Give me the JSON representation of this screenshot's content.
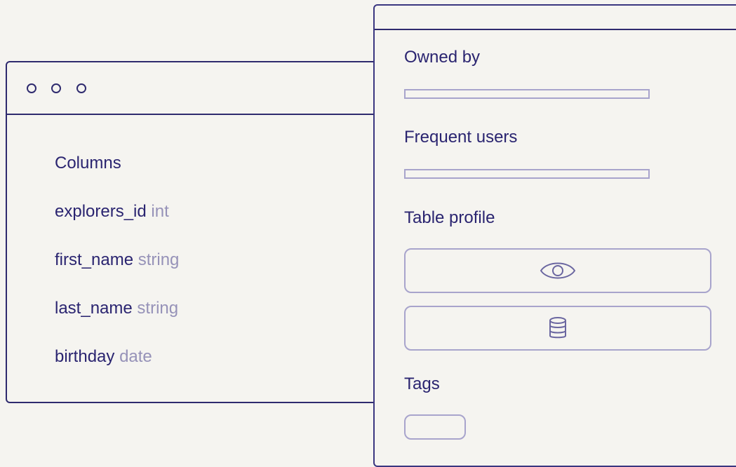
{
  "schema_window": {
    "heading": "Columns",
    "columns": [
      {
        "name": "explorers_id",
        "type": "int"
      },
      {
        "name": "first_name",
        "type": "string"
      },
      {
        "name": "last_name",
        "type": "string"
      },
      {
        "name": "birthday",
        "type": "date"
      }
    ]
  },
  "details_panel": {
    "owned_by_label": "Owned by",
    "frequent_users_label": "Frequent users",
    "table_profile_label": "Table profile",
    "tags_label": "Tags",
    "profile_buttons": [
      {
        "icon": "eye-icon"
      },
      {
        "icon": "database-icon"
      }
    ]
  },
  "colors": {
    "background": "#f5f4f0",
    "ink": "#2a2470",
    "muted": "#9692b8",
    "outline": "#a8a4cc"
  }
}
